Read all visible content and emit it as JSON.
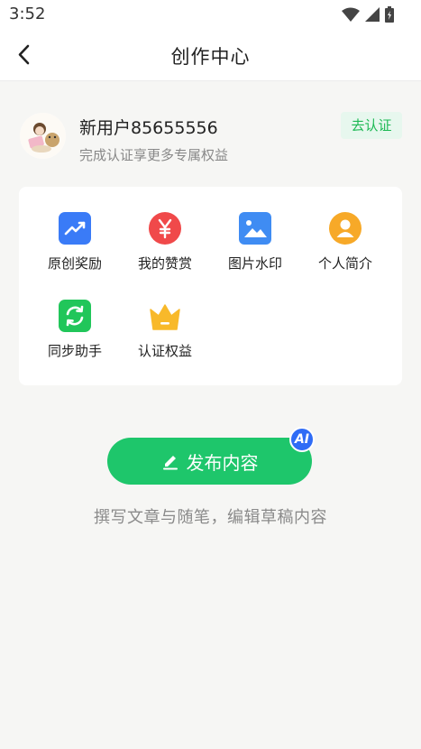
{
  "status_bar": {
    "time": "3:52"
  },
  "header": {
    "title": "创作中心"
  },
  "profile": {
    "username": "新用户85655556",
    "subtitle": "完成认证享更多专属权益",
    "verify_label": "去认证"
  },
  "tools": [
    {
      "label": "原创奖励",
      "icon": "trend-icon",
      "color": "#3a7bf7"
    },
    {
      "label": "我的赞赏",
      "icon": "yuan-icon",
      "color": "#f0494a"
    },
    {
      "label": "图片水印",
      "icon": "image-icon",
      "color": "#3f8cf3"
    },
    {
      "label": "个人简介",
      "icon": "person-icon",
      "color": "#f7a928"
    },
    {
      "label": "同步助手",
      "icon": "sync-icon",
      "color": "#21c65a"
    },
    {
      "label": "认证权益",
      "icon": "crown-icon",
      "color": "#f8b92a"
    }
  ],
  "publish": {
    "label": "发布内容",
    "badge": "AI",
    "hint": "撰写文章与随笔，编辑草稿内容"
  },
  "colors": {
    "accent": "#1ec66b",
    "background": "#f6f6f4"
  }
}
